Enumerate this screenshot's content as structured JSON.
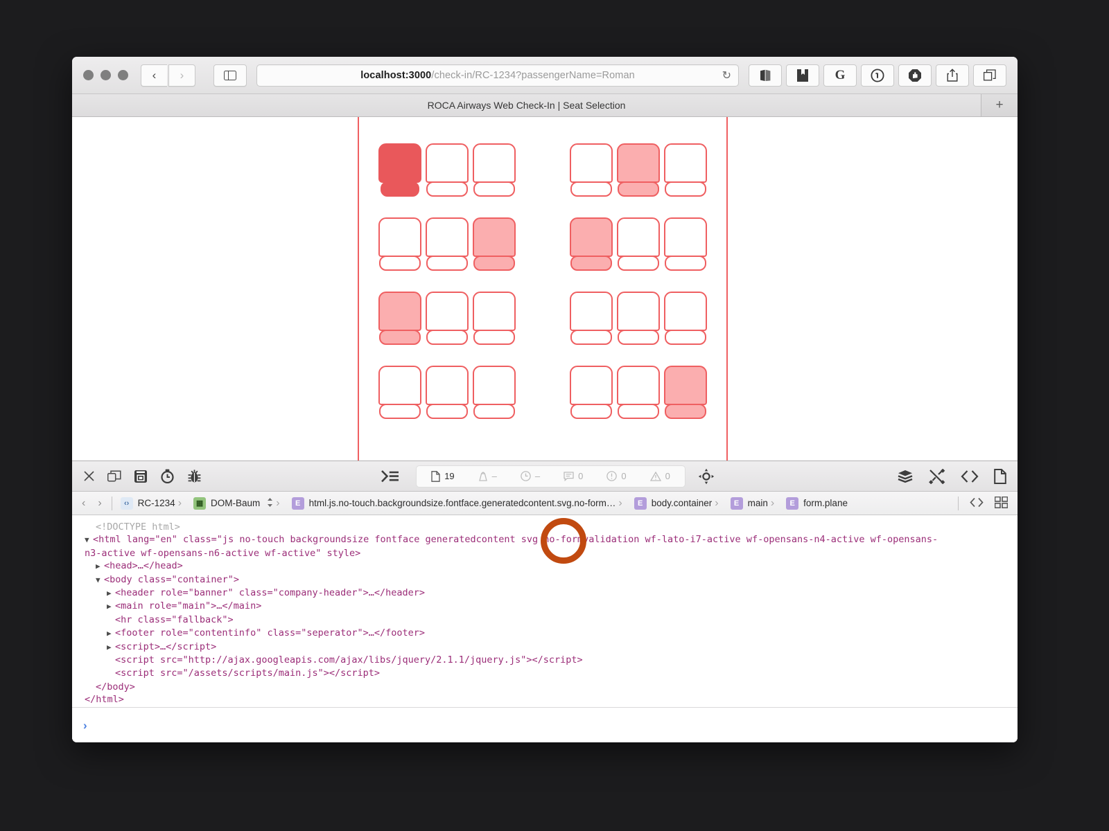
{
  "browser": {
    "traffic_lights": [
      "close",
      "minimize",
      "zoom"
    ],
    "back_label": "‹",
    "forward_label": "›",
    "sidebar_icon": "sidebar-icon",
    "url_bold": "localhost:3000",
    "url_rest": "/check-in/RC-1234?passengerName=Roman",
    "url_full": "localhost:3000/check-in/RC-1234?passengerName=Roman",
    "reload_label": "↻",
    "extensions": [
      {
        "name": "reading-list-icon",
        "glyph": "🕮"
      },
      {
        "name": "bookmarks-icon",
        "glyph": "🔖"
      },
      {
        "name": "grammarly-icon",
        "glyph": "G"
      },
      {
        "name": "onepassword-icon",
        "glyph": "①"
      },
      {
        "name": "adblock-icon",
        "glyph": "✋"
      },
      {
        "name": "share-icon",
        "glyph": "⇧"
      },
      {
        "name": "show-tabs-icon",
        "glyph": "⧉"
      }
    ],
    "tab_title": "ROCA Airways Web Check-In | Seat Selection",
    "new_tab_label": "+"
  },
  "seatmap": {
    "rows": [
      {
        "left": [
          "selected",
          "free",
          "free"
        ],
        "right": [
          "free",
          "occupied",
          "free"
        ]
      },
      {
        "left": [
          "free",
          "free",
          "occupied"
        ],
        "right": [
          "occupied",
          "free",
          "free"
        ]
      },
      {
        "left": [
          "occupied",
          "free",
          "free"
        ],
        "right": [
          "free",
          "free",
          "free"
        ]
      },
      {
        "left": [
          "free",
          "free",
          "free"
        ],
        "right": [
          "free",
          "free",
          "occupied"
        ]
      }
    ],
    "colors": {
      "outline": "#ef5f61",
      "selected": "#e9585b",
      "occupied": "#fbaeaf",
      "free": "#ffffff"
    }
  },
  "devtools": {
    "left_icons": [
      {
        "name": "close-devtools-icon",
        "glyph": "✕"
      },
      {
        "name": "undock-panel-icon",
        "glyph": "⧉"
      },
      {
        "name": "elements-panel-icon",
        "glyph": "▤"
      },
      {
        "name": "timeline-panel-icon",
        "glyph": "⏱"
      },
      {
        "name": "debugger-panel-icon",
        "glyph": "🐞"
      }
    ],
    "console-toggle": {
      "name": "console-prompt-icon",
      "glyph": "≫≡"
    },
    "stats": [
      {
        "name": "resource-count",
        "icon": "document-icon",
        "value": "19"
      },
      {
        "name": "resource-size",
        "icon": "weight-icon",
        "value": "–"
      },
      {
        "name": "load-time",
        "icon": "clock-icon",
        "value": "–"
      },
      {
        "name": "log-count",
        "icon": "message-icon",
        "value": "0"
      },
      {
        "name": "error-count",
        "icon": "error-icon",
        "value": "0"
      },
      {
        "name": "warning-count",
        "icon": "warning-icon",
        "value": "0"
      }
    ],
    "node-select": {
      "name": "select-node-icon",
      "glyph": "✥"
    },
    "right_icons": [
      {
        "name": "layers-icon",
        "glyph": "☰"
      },
      {
        "name": "styles-icon",
        "glyph": "✂"
      },
      {
        "name": "code-icon",
        "glyph": "‹›"
      },
      {
        "name": "document-icon",
        "glyph": "🗎"
      }
    ],
    "breadcrumb": {
      "back": "‹",
      "forward": "›",
      "items": [
        {
          "badge": "code",
          "badge_text": "‹›",
          "label": "RC-1234",
          "stepper": ""
        },
        {
          "badge": "dom",
          "badge_text": "▦",
          "label": "DOM-Baum",
          "stepper": "⌃⌄"
        },
        {
          "badge": "el",
          "badge_text": "E",
          "label": "html.js.no-touch.backgroundsize.fontface.generatedcontent.svg.no-form…",
          "stepper": ""
        },
        {
          "badge": "el",
          "badge_text": "E",
          "label": "body.container",
          "stepper": ""
        },
        {
          "badge": "el",
          "badge_text": "E",
          "label": "main",
          "stepper": ""
        },
        {
          "badge": "el",
          "badge_text": "E",
          "label": "form.plane",
          "stepper": ""
        }
      ],
      "right_icons": [
        {
          "name": "source-code-icon",
          "glyph": "‹›"
        },
        {
          "name": "grid-layout-icon",
          "glyph": "▦"
        }
      ]
    },
    "dom": {
      "doctype": "<!DOCTYPE html>",
      "html_open_a": "<html lang=\"en\" class=\"js no-touch backgroundsize fontface generatedcontent svg no-formvalidation wf-lato-i7-active wf-opensans-n4-active wf-opensans-",
      "html_open_b": "n3-active wf-opensans-n6-active wf-active\" style>",
      "head_line": "<head>…</head>",
      "body_open": "<body class=\"container\">",
      "header_line": "<header role=\"banner\" class=\"company-header\">…</header>",
      "main_line": "<main role=\"main\">…</main>",
      "hr_line": "<hr class=\"fallback\">",
      "footer_line": "<footer role=\"contentinfo\" class=\"seperator\">…</footer>",
      "script_inline": "<script>…</script>",
      "script_jquery": "<script src=\"http://ajax.googleapis.com/ajax/libs/jquery/2.1.1/jquery.js\"></script>",
      "script_main": "<script src=\"/assets/scripts/main.js\"></script>",
      "body_close": "</body>",
      "html_close": "</html>"
    },
    "annotation": {
      "name": "highlight-circle",
      "color": "#c14a10"
    },
    "console_prompt": "›"
  }
}
